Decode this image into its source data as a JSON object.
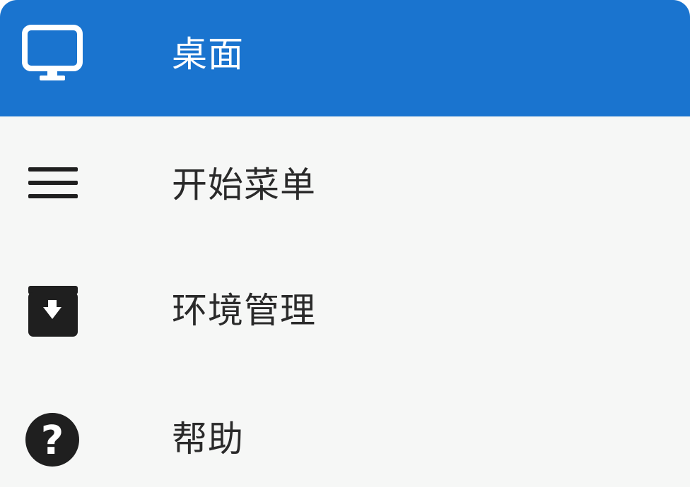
{
  "menu": {
    "items": [
      {
        "label": "桌面",
        "icon": "monitor-icon",
        "selected": true
      },
      {
        "label": "开始菜单",
        "icon": "hamburger-menu-icon",
        "selected": false
      },
      {
        "label": "环境管理",
        "icon": "archive-download-icon",
        "selected": false
      },
      {
        "label": "帮助",
        "icon": "help-circle-icon",
        "selected": false
      }
    ]
  },
  "colors": {
    "selected_background": "#1a74cf",
    "background": "#f6f7f6",
    "selected_text": "#ffffff",
    "text": "#2a2a2a",
    "icon": "#1f1f1f"
  }
}
